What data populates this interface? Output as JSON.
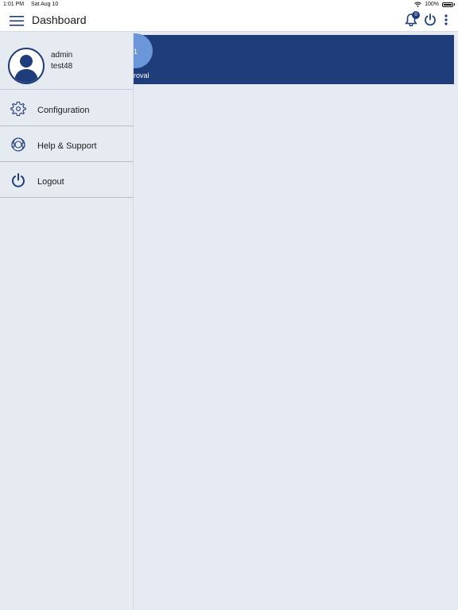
{
  "status_bar": {
    "time": "1:01 PM",
    "date": "Sat Aug 10",
    "battery": "100%"
  },
  "header": {
    "title": "Dashboard",
    "notification_count": "0"
  },
  "main": {
    "summary_count": "1",
    "summary_label": "roval"
  },
  "drawer": {
    "role": "admin",
    "username": "test48",
    "items": [
      {
        "label": "Configuration",
        "icon": "gear-icon"
      },
      {
        "label": "Help & Support",
        "icon": "support-icon"
      },
      {
        "label": "Logout",
        "icon": "power-icon"
      }
    ]
  },
  "colors": {
    "primary": "#1f3d7a",
    "accent_light": "#6b97d8",
    "background": "#e6ebf3"
  }
}
